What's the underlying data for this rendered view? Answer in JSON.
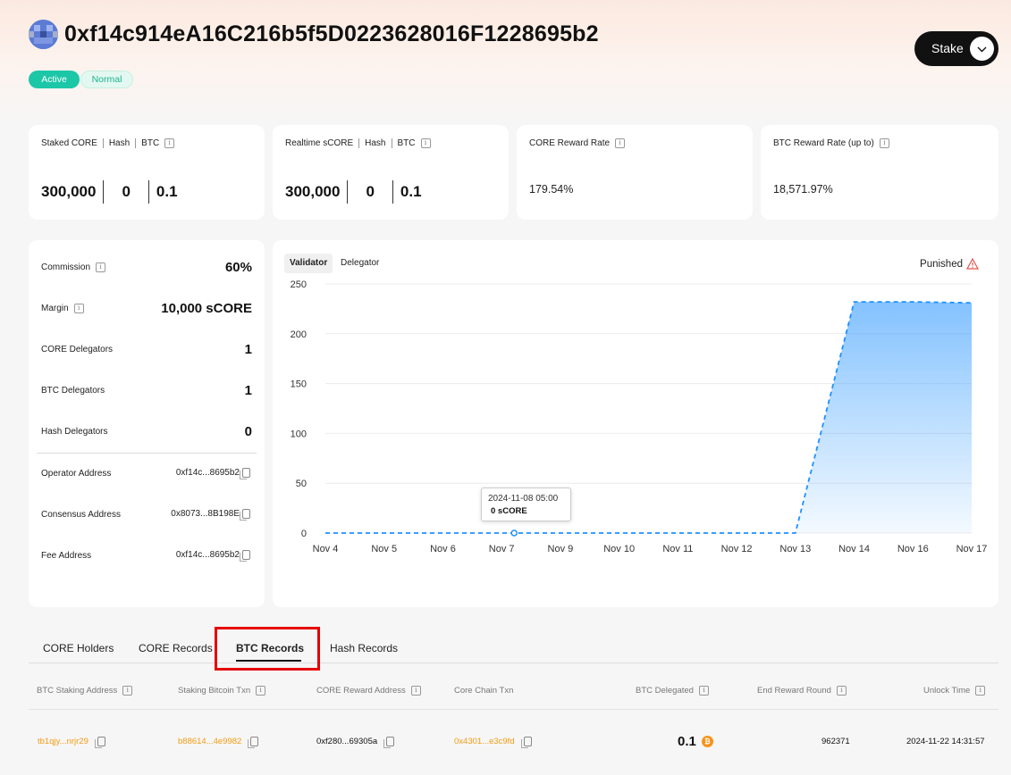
{
  "header": {
    "address": "0xf14c914eA16C216b5f5D0223628016F1228695b2",
    "status_badge": "Active",
    "type_badge": "Normal",
    "stake_button": "Stake"
  },
  "stats": [
    {
      "labels": [
        "Staked CORE",
        "Hash",
        "BTC"
      ],
      "values": [
        "300,000",
        "0",
        "0.1"
      ]
    },
    {
      "labels": [
        "Realtime sCORE",
        "Hash",
        "BTC"
      ],
      "values": [
        "300,000",
        "0",
        "0.1"
      ]
    },
    {
      "label": "CORE Reward Rate",
      "value": "179.54%"
    },
    {
      "label": "BTC Reward Rate (up to)",
      "value": "18,571.97%"
    }
  ],
  "details": {
    "commission_label": "Commission",
    "commission": "60%",
    "margin_label": "Margin",
    "margin": "10,000 sCORE",
    "core_delegators_label": "CORE Delegators",
    "core_delegators": "1",
    "btc_delegators_label": "BTC Delegators",
    "btc_delegators": "1",
    "hash_delegators_label": "Hash Delegators",
    "hash_delegators": "0",
    "operator_label": "Operator Address",
    "operator": "0xf14c...8695b2",
    "consensus_label": "Consensus Address",
    "consensus": "0x8073...8B198E",
    "fee_label": "Fee Address",
    "fee": "0xf14c...8695b2"
  },
  "chart_tabs": {
    "validator": "Validator",
    "delegator": "Delegator",
    "punished": "Punished"
  },
  "tooltip": {
    "date": "2024-11-08 05:00",
    "value": "0 sCORE"
  },
  "chart_data": {
    "type": "area",
    "x": [
      "Nov 4",
      "Nov 5",
      "Nov 6",
      "Nov 7",
      "Nov 9",
      "Nov 10",
      "Nov 11",
      "Nov 12",
      "Nov 13",
      "Nov 14",
      "Nov 16",
      "Nov 17"
    ],
    "series": [
      {
        "values": [
          0,
          0,
          0,
          0,
          0,
          0,
          0,
          0,
          0,
          232,
          232,
          231
        ]
      }
    ],
    "y_ticks": [
      "250",
      "200",
      "150",
      "100",
      "50",
      "0"
    ],
    "ylim": [
      0,
      250
    ],
    "color": "#1e90ff",
    "grid": true
  },
  "record_tabs": [
    "CORE Holders",
    "CORE Records",
    "BTC Records",
    "Hash Records"
  ],
  "table": {
    "headers": [
      "BTC Staking Address",
      "Staking Bitcoin Txn",
      "CORE Reward Address",
      "Core Chain Txn",
      "BTC Delegated",
      "End Reward Round",
      "Unlock Time"
    ],
    "rows": [
      {
        "staking_address": "tb1qjy...nrjr29",
        "staking_txn": "b88614...4e9982",
        "reward_address": "0xf280...69305a",
        "core_txn": "0x4301...e3c9fd",
        "delegated": "0.1",
        "end_round": "962371",
        "unlock_time": "2024-11-22 14:31:57"
      }
    ]
  }
}
